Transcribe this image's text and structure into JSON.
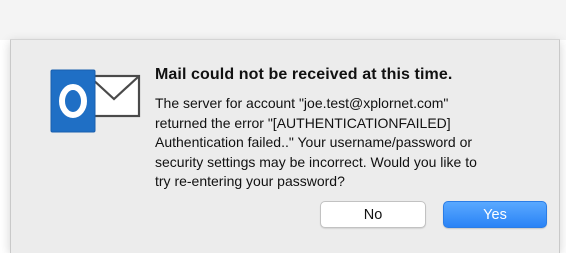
{
  "dialog": {
    "title": "Mail could not be received at this time.",
    "message_lines": [
      "The server for account \"joe.test@xplornet.com\"",
      "returned the error \"[AUTHENTICATIONFAILED]",
      "Authentication failed..\" Your username/password or",
      "security settings may be incorrect. Would you like to",
      "try re-entering your password?"
    ],
    "buttons": {
      "no_label": "No",
      "yes_label": "Yes"
    }
  },
  "icons": {
    "app_icon": "outlook-mail-icon"
  },
  "colors": {
    "outlook_blue": "#1f6fc5",
    "default_button": "#2a83f6"
  }
}
